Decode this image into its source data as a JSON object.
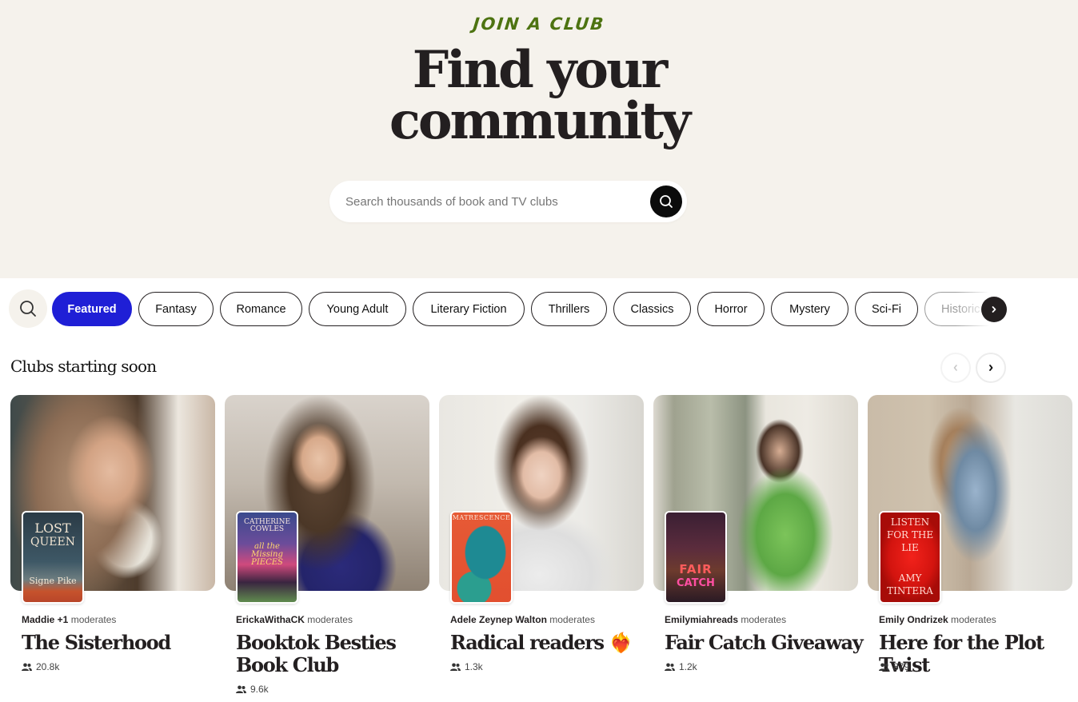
{
  "hero": {
    "eyebrow": "JOIN A CLUB",
    "title_line1": "Find your",
    "title_line2": "community",
    "search_placeholder": "Search thousands of book and TV clubs",
    "search_value": "",
    "search_button_icon": "search-icon"
  },
  "categories": {
    "search_icon": "search-icon",
    "items": [
      {
        "label": "Featured",
        "active": true
      },
      {
        "label": "Fantasy",
        "active": false
      },
      {
        "label": "Romance",
        "active": false
      },
      {
        "label": "Young Adult",
        "active": false
      },
      {
        "label": "Literary Fiction",
        "active": false
      },
      {
        "label": "Thrillers",
        "active": false
      },
      {
        "label": "Classics",
        "active": false
      },
      {
        "label": "Horror",
        "active": false
      },
      {
        "label": "Mystery",
        "active": false
      },
      {
        "label": "Sci-Fi",
        "active": false
      },
      {
        "label": "Historic",
        "active": false
      }
    ],
    "next_icon": "chevron-right-icon"
  },
  "section": {
    "title": "Clubs starting soon",
    "prev_icon": "chevron-left-icon",
    "next_icon": "chevron-right-icon"
  },
  "clubs": [
    {
      "moderator": "Maddie +1",
      "moderates_label": "moderates",
      "title": "The Sisterhood",
      "members": "20.8k",
      "book": {
        "line1": "LOST",
        "line2": "QUEEN",
        "author": "Signe Pike"
      }
    },
    {
      "moderator": "ErickaWithaCK",
      "moderates_label": "moderates",
      "title": "Booktok Besties Book Club",
      "members": "9.6k",
      "book": {
        "line1": "CATHERINE COWLES",
        "line2": "all the Missing PIECES",
        "author": ""
      }
    },
    {
      "moderator": "Adele Zeynep Walton",
      "moderates_label": "moderates",
      "title": "Radical readers ❤️‍🔥",
      "members": "1.3k",
      "book": {
        "line1": "MATRESCENCE",
        "line2": "",
        "author": ""
      }
    },
    {
      "moderator": "Emilymiahreads",
      "moderates_label": "moderates",
      "title": "Fair Catch Giveaway",
      "members": "1.2k",
      "book": {
        "line1": "FAIR",
        "line2": "CATCH",
        "author": ""
      }
    },
    {
      "moderator": "Emily Ondrizek",
      "moderates_label": "moderates",
      "title": "Here for the Plot Twist",
      "members": "879",
      "book": {
        "line1": "LISTEN FOR THE LIE",
        "line2": "AMY TINTERA",
        "author": ""
      }
    }
  ],
  "colors": {
    "hero_bg": "#f5f2ec",
    "eyebrow": "#4d7311",
    "accent_chip": "#1f1fd6",
    "text_dark": "#231f20"
  }
}
